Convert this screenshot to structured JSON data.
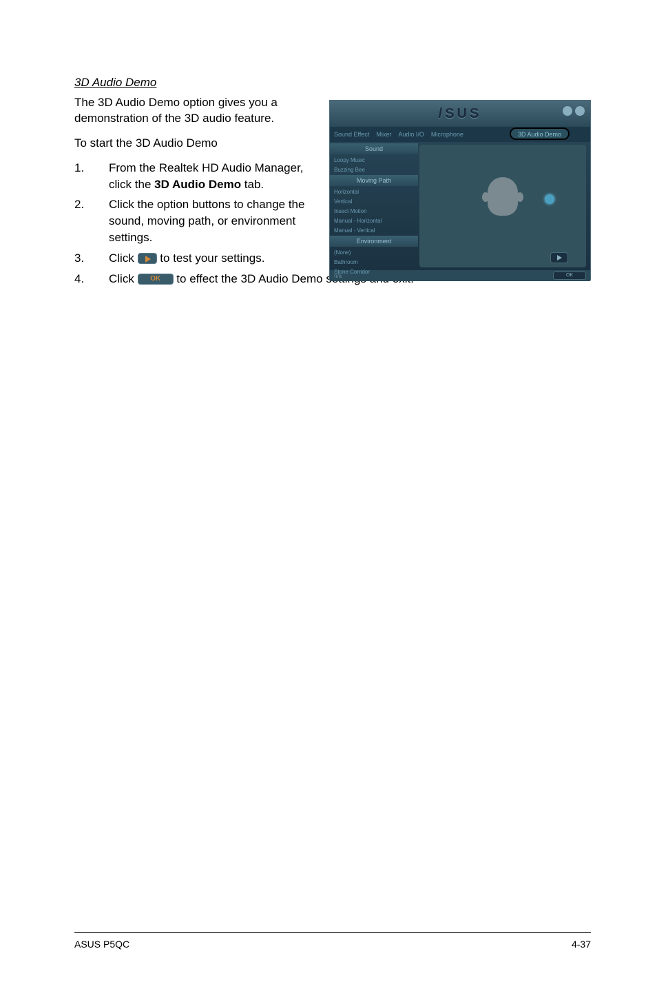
{
  "heading": "3D Audio Demo",
  "intro": "The 3D Audio Demo option gives you a demonstration of the 3D audio feature.",
  "to_start": "To start the 3D Audio Demo",
  "steps": [
    {
      "num": "1.",
      "prefix": "From the Realtek HD Audio Manager, click the ",
      "bold": "3D Audio Demo",
      "suffix": " tab."
    },
    {
      "num": "2.",
      "prefix": "Click the option buttons to change the sound, moving path, or environment settings.",
      "bold": "",
      "suffix": ""
    },
    {
      "num": "3.",
      "prefix": "Click ",
      "icon": "play",
      "suffix": " to test your settings."
    },
    {
      "num": "4.",
      "prefix": "Click ",
      "icon": "ok",
      "suffix": " to effect the 3D Audio Demo settings and exit."
    }
  ],
  "ok_label": "OK",
  "screenshot": {
    "brand": "/SUS",
    "tabs": [
      "Sound Effect",
      "Mixer",
      "Audio I/O",
      "Microphone"
    ],
    "active_tab": "3D Audio Demo",
    "sections": {
      "sound": {
        "title": "Sound",
        "items": [
          "Loopy Music",
          "Buzzing Bee"
        ]
      },
      "moving": {
        "title": "Moving Path",
        "items": [
          "Horizontal",
          "Vertical",
          "Insect Motion",
          "Manual - Horizontal",
          "Manual - Vertical"
        ]
      },
      "env": {
        "title": "Environment",
        "items": [
          "(None)",
          "Bathroom",
          "Stone Corridor"
        ]
      }
    },
    "footer_left": "n/a",
    "footer_ok": "OK"
  },
  "footer": {
    "left": "ASUS P5QC",
    "right": "4-37"
  }
}
